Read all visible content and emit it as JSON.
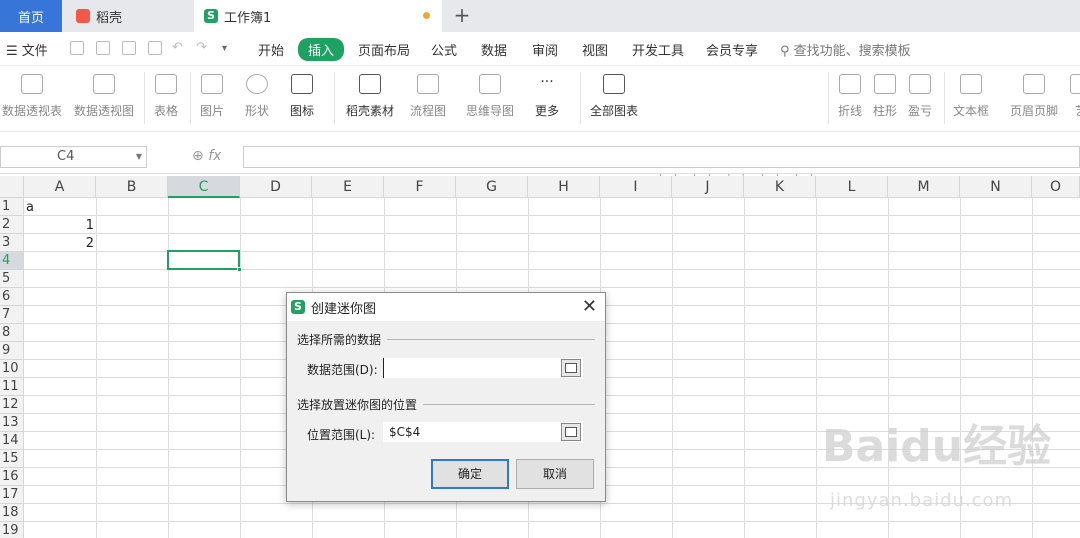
{
  "tabs": {
    "home": "首页",
    "doc": "稻壳",
    "workbook": "工作簿1",
    "new": "+"
  },
  "menu": {
    "file": "文件",
    "items": [
      "开始",
      "插入",
      "页面布局",
      "公式",
      "数据",
      "审阅",
      "视图",
      "开发工具",
      "会员专享"
    ],
    "active": "插入",
    "search": "查找功能、搜索模板"
  },
  "ribbon": {
    "buttons": [
      "数据透视表",
      "数据透视图",
      "表格",
      "图片",
      "形状",
      "图标",
      "稻壳素材",
      "流程图",
      "思维导图",
      "更多",
      "全部图表",
      "折线",
      "柱形",
      "盈亏",
      "文本框",
      "页眉页脚",
      "艺"
    ]
  },
  "formula": {
    "namebox": "C4",
    "fx": "fx",
    "value": ""
  },
  "sheet": {
    "columns": [
      "A",
      "B",
      "C",
      "D",
      "E",
      "F",
      "G",
      "H",
      "I",
      "J",
      "K",
      "L",
      "M",
      "N",
      "O"
    ],
    "rows": [
      "1",
      "2",
      "3",
      "4",
      "5",
      "6",
      "7",
      "8",
      "9",
      "10",
      "11",
      "12",
      "13",
      "14",
      "15",
      "16",
      "17",
      "18",
      "19"
    ],
    "selected_col": "C",
    "selected_row": "4",
    "cells": {
      "A1": "a",
      "A2": "1",
      "A3": "2"
    }
  },
  "dialog": {
    "title": "创建迷你图",
    "section1": "选择所需的数据",
    "data_range_label": "数据范围(D):",
    "data_range_value": "",
    "section2": "选择放置迷你图的位置",
    "location_label": "位置范围(L):",
    "location_value": "$C$4",
    "ok": "确定",
    "cancel": "取消",
    "close": "✕"
  },
  "watermark": {
    "brand": "Baidu经验",
    "url": "jingyan.baidu.com"
  }
}
